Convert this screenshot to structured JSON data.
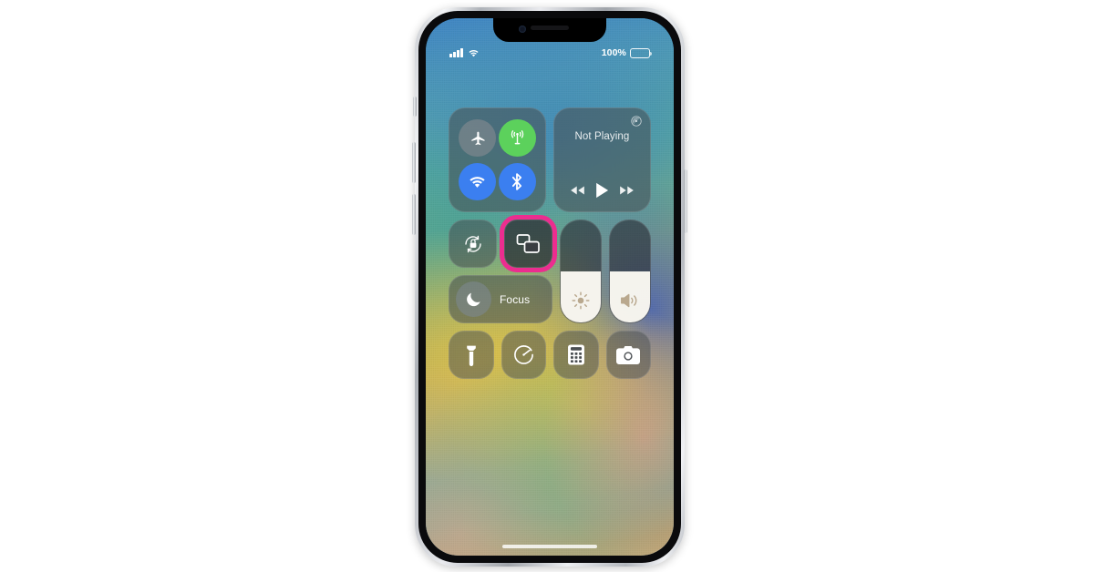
{
  "device": {
    "name": "iphone-13",
    "frame_color": "#c9ccd1"
  },
  "highlight": {
    "color": "#ec2d8f",
    "target": "screen-mirroring-button"
  },
  "status_bar": {
    "signal_icon": "cellular-bars-icon",
    "wifi_icon": "wifi-icon",
    "battery_percent": "100%",
    "battery_icon": "battery-full-icon"
  },
  "control_center": {
    "connectivity": {
      "label": "connectivity-module",
      "toggles": [
        {
          "name": "airplane-mode-toggle",
          "icon": "airplane-icon",
          "state": "off"
        },
        {
          "name": "cellular-data-toggle",
          "icon": "cellular-antenna-icon",
          "state": "on"
        },
        {
          "name": "wifi-toggle",
          "icon": "wifi-icon",
          "state": "on"
        },
        {
          "name": "bluetooth-toggle",
          "icon": "bluetooth-icon",
          "state": "on"
        }
      ]
    },
    "media": {
      "title": "Not Playing",
      "airplay_icon": "airplay-audio-icon",
      "controls": [
        {
          "name": "rewind-button",
          "icon": "rewind-icon"
        },
        {
          "name": "play-button",
          "icon": "play-icon"
        },
        {
          "name": "fast-forward-button",
          "icon": "fast-forward-icon"
        }
      ]
    },
    "rotation_lock": {
      "label": "rotation-lock-button",
      "icon": "rotation-lock-icon"
    },
    "screen_mirroring": {
      "label": "screen-mirroring-button",
      "icon": "screen-mirroring-icon"
    },
    "focus": {
      "label": "Focus",
      "icon": "moon-icon"
    },
    "brightness": {
      "name": "brightness-slider",
      "icon": "brightness-sun-icon",
      "level": 50
    },
    "volume": {
      "name": "volume-slider",
      "icon": "speaker-wave-icon",
      "level": 50
    },
    "shortcuts": [
      {
        "name": "flashlight-button",
        "icon": "flashlight-icon"
      },
      {
        "name": "timer-button",
        "icon": "timer-icon"
      },
      {
        "name": "calculator-button",
        "icon": "calculator-icon"
      },
      {
        "name": "camera-button",
        "icon": "camera-icon"
      }
    ]
  },
  "home_indicator": {
    "name": "home-indicator"
  }
}
